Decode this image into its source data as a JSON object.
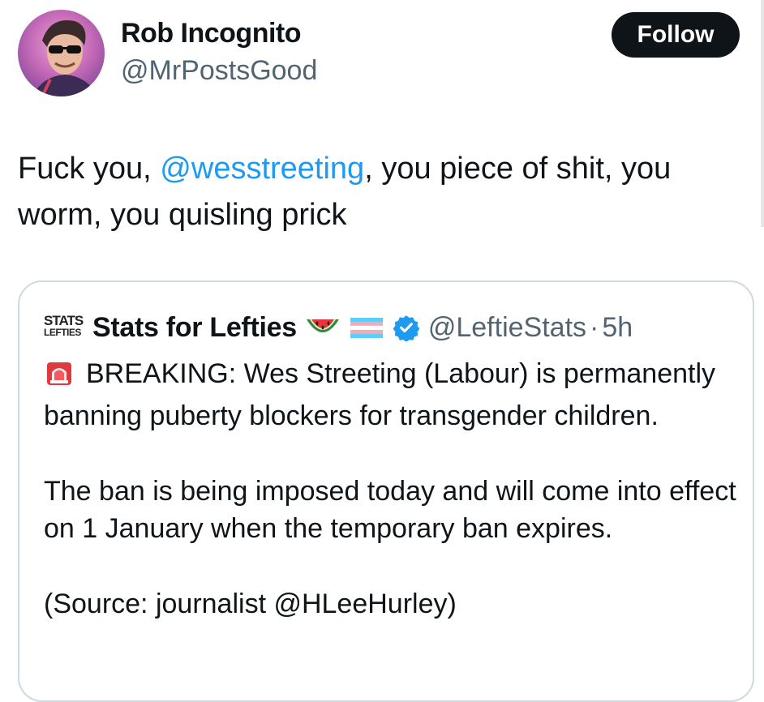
{
  "tweet": {
    "author": {
      "name": "Rob Incognito",
      "handle": "@MrPostsGood",
      "avatar_icon": "profile-photo"
    },
    "follow_label": "Follow",
    "text_before": "Fuck you, ",
    "mention": "@wesstreeting",
    "text_after": ", you piece of shit, you worm, you quisling prick"
  },
  "quote": {
    "logo_line1": "STATS",
    "logo_line2": "LEFTIES",
    "name": "Stats for Lefties",
    "emojis": [
      "watermelon-icon",
      "trans-flag-icon",
      "verified-badge-icon"
    ],
    "handle": "@LeftieStats",
    "separator": "·",
    "time": "5h",
    "siren_icon": "siren-icon",
    "paragraph1": "BREAKING: Wes Streeting (Labour) is permanently banning puberty blockers for transgender children.",
    "paragraph2": "The ban is being imposed today and will come into effect on 1 January when the temporary ban expires.",
    "paragraph3": "(Source: journalist @HLeeHurley)"
  },
  "colors": {
    "link": "#1d9bf0",
    "secondary_text": "#536471",
    "border": "#cfd9de",
    "follow_bg": "#0f1419",
    "verified": "#1d9bf0"
  }
}
